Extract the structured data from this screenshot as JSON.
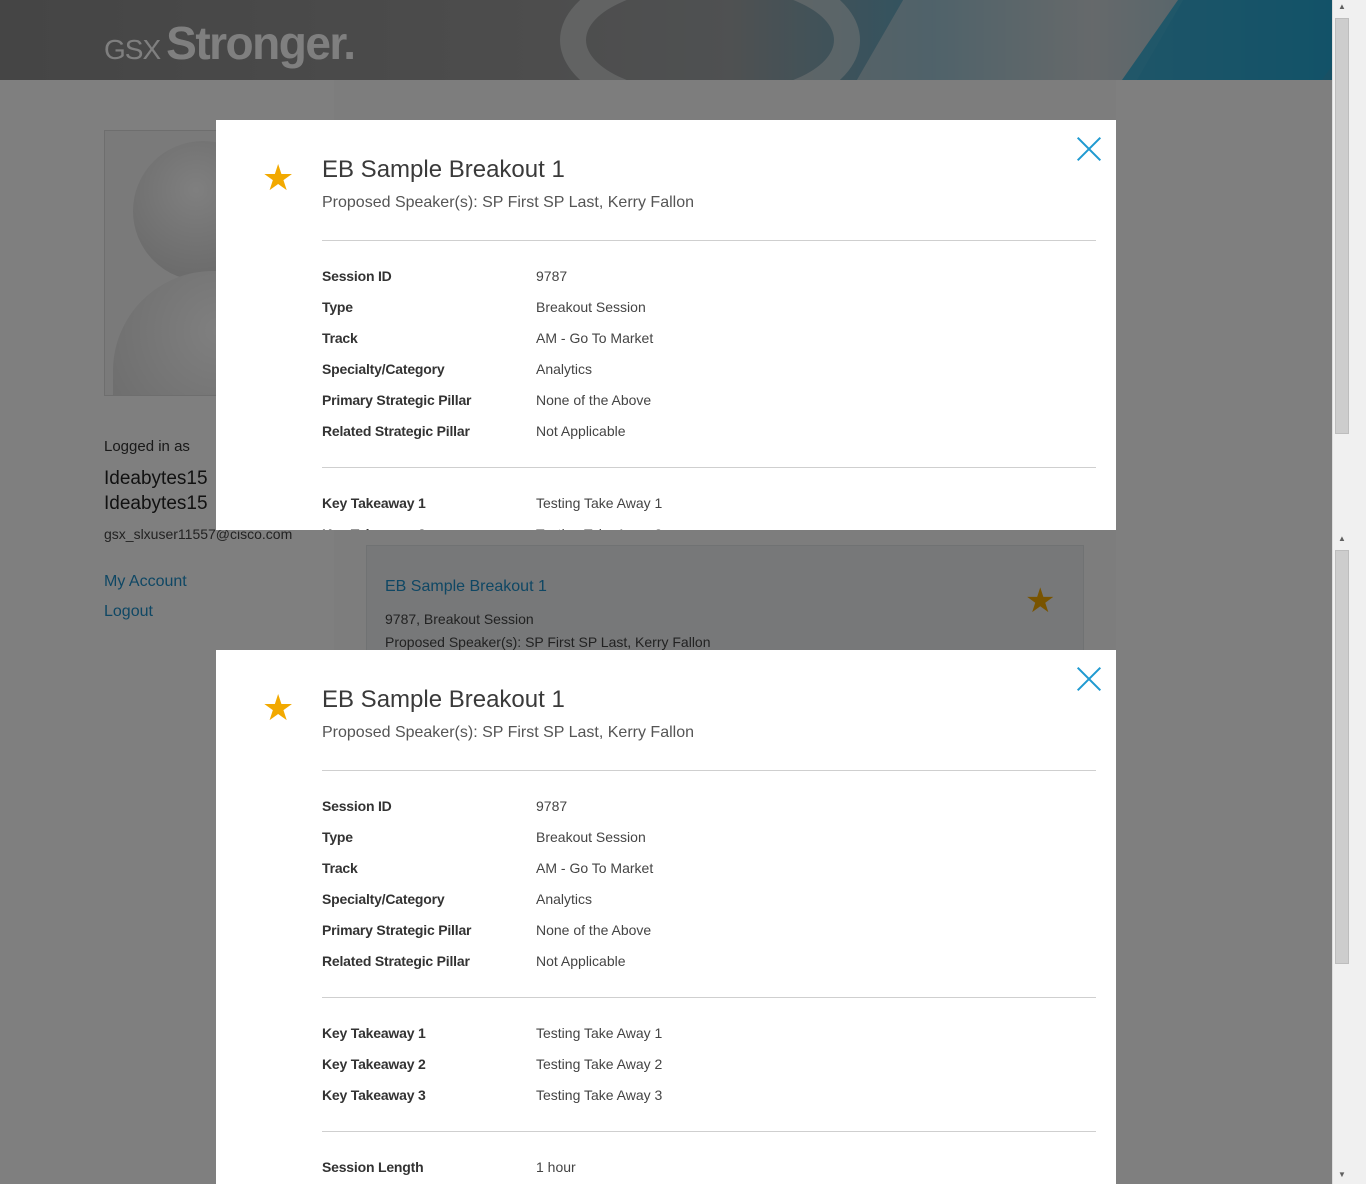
{
  "header": {
    "logo_gsx": "GSX",
    "logo_stronger": "Stronger."
  },
  "sidebar": {
    "logged_in_label": "Logged in as",
    "user_name_line1": "Ideabytes15",
    "user_name_line2": "Ideabytes15",
    "email": "gsx_slxuser11557@cisco.com",
    "my_account": "My Account",
    "logout": "Logout"
  },
  "card": {
    "title": "EB Sample Breakout 1",
    "meta": "9787, Breakout Session",
    "speakers": "Proposed Speaker(s): SP First SP Last,  Kerry Fallon"
  },
  "modal": {
    "title": "EB Sample Breakout 1",
    "speakers": "Proposed Speaker(s): SP First SP Last,  Kerry Fallon",
    "details": [
      {
        "label": "Session ID",
        "value": "9787"
      },
      {
        "label": "Type",
        "value": "Breakout Session"
      },
      {
        "label": "Track",
        "value": "AM - Go To Market"
      },
      {
        "label": "Specialty/Category",
        "value": "Analytics"
      },
      {
        "label": "Primary Strategic Pillar",
        "value": "None of the Above"
      },
      {
        "label": "Related Strategic Pillar",
        "value": "Not Applicable"
      }
    ],
    "takeaways": [
      {
        "label": "Key Takeaway 1",
        "value": "Testing Take Away 1"
      },
      {
        "label": "Key Takeaway 2",
        "value": "Testing Take Away 2"
      },
      {
        "label": "Key Takeaway 3",
        "value": "Testing Take Away 3"
      }
    ],
    "session_length": {
      "label": "Session Length",
      "value": "1 hour"
    }
  },
  "colors": {
    "accent": "#1f9ad1",
    "star": "#f2a900",
    "link": "#1f8fc8"
  }
}
